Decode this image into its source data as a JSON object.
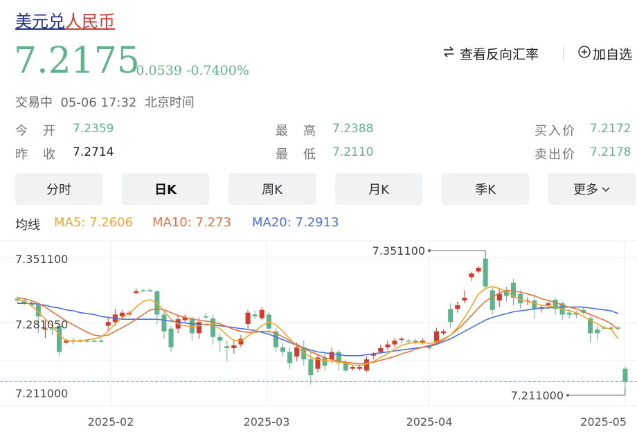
{
  "pair": {
    "base": "美元兑",
    "quote": "人民币"
  },
  "price": "7.2175",
  "change": "-0.0539",
  "change_pct": "-0.7400%",
  "actions": {
    "reverse_label": "查看反向汇率",
    "add_label": "加自选"
  },
  "status": {
    "state": "交易中",
    "time": "05-06 17:32",
    "zone": "北京时间"
  },
  "stats": {
    "open_label": "今　开",
    "open": "7.2359",
    "prev_label": "昨　收",
    "prev": "7.2714",
    "high_label": "最　高",
    "high": "7.2388",
    "low_label": "最　低",
    "low": "7.2110",
    "buy_label": "买入价",
    "buy": "7.2172",
    "sell_label": "卖出价",
    "sell": "7.2178"
  },
  "tabs": [
    "分时",
    "日K",
    "周K",
    "月K",
    "季K",
    "更多"
  ],
  "active_tab": "日K",
  "ma": {
    "label": "均线",
    "ma5": "MA5: 7.2606",
    "ma10": "MA10: 7.273",
    "ma20": "MA20: 7.2913"
  },
  "colors": {
    "up": "#d33a2c",
    "down": "#5fb38a",
    "ma5": "#f0a62a",
    "ma10": "#e0743a",
    "ma20": "#4a6fe0"
  },
  "chart_data": {
    "type": "candlestick",
    "y_ticks": [
      "7.351100",
      "7.281050",
      "7.211000"
    ],
    "x_ticks": [
      "2025-02",
      "2025-03",
      "2025-04",
      "2025-05"
    ],
    "ylim": [
      7.2,
      7.37
    ],
    "high_marker": "7.351100",
    "low_marker": "7.211000",
    "candles": [
      [
        7.307,
        7.305,
        7.309,
        7.303
      ],
      [
        7.305,
        7.302,
        7.308,
        7.3
      ],
      [
        7.302,
        7.3,
        7.304,
        7.298
      ],
      [
        7.3,
        7.288,
        7.302,
        7.27
      ],
      [
        7.274,
        7.275,
        7.285,
        7.265
      ],
      [
        7.275,
        7.274,
        7.282,
        7.268
      ],
      [
        7.278,
        7.25,
        7.28,
        7.245
      ],
      [
        7.26,
        7.262,
        7.264,
        7.258
      ],
      [
        7.262,
        7.262,
        7.265,
        7.258
      ],
      [
        7.262,
        7.262,
        7.264,
        7.26
      ],
      [
        7.262,
        7.262,
        7.264,
        7.26
      ],
      [
        7.262,
        7.262,
        7.264,
        7.26
      ],
      [
        7.262,
        7.262,
        7.264,
        7.26
      ],
      [
        7.278,
        7.282,
        7.288,
        7.272
      ],
      [
        7.282,
        7.29,
        7.296,
        7.278
      ],
      [
        7.288,
        7.292,
        7.295,
        7.285
      ],
      [
        7.29,
        7.292,
        7.294,
        7.288
      ],
      [
        7.313,
        7.315,
        7.318,
        7.312
      ],
      [
        7.316,
        7.316,
        7.318,
        7.314
      ],
      [
        7.316,
        7.316,
        7.318,
        7.314
      ],
      [
        7.315,
        7.29,
        7.316,
        7.28
      ],
      [
        7.29,
        7.272,
        7.294,
        7.264
      ],
      [
        7.275,
        7.255,
        7.278,
        7.25
      ],
      [
        7.275,
        7.285,
        7.29,
        7.27
      ],
      [
        7.284,
        7.287,
        7.29,
        7.282
      ],
      [
        7.286,
        7.27,
        7.288,
        7.262
      ],
      [
        7.27,
        7.282,
        7.287,
        7.264
      ],
      [
        7.288,
        7.287,
        7.292,
        7.285
      ],
      [
        7.286,
        7.266,
        7.29,
        7.258
      ],
      [
        7.266,
        7.262,
        7.27,
        7.25
      ],
      [
        7.256,
        7.254,
        7.262,
        7.24
      ],
      [
        7.254,
        7.257,
        7.262,
        7.248
      ],
      [
        7.258,
        7.264,
        7.268,
        7.255
      ],
      [
        7.28,
        7.292,
        7.295,
        7.275
      ],
      [
        7.29,
        7.288,
        7.294,
        7.285
      ],
      [
        7.286,
        7.295,
        7.298,
        7.284
      ],
      [
        7.29,
        7.275,
        7.293,
        7.27
      ],
      [
        7.272,
        7.255,
        7.276,
        7.25
      ],
      [
        7.255,
        7.25,
        7.26,
        7.245
      ],
      [
        7.25,
        7.238,
        7.255,
        7.232
      ],
      [
        7.245,
        7.255,
        7.26,
        7.24
      ],
      [
        7.255,
        7.242,
        7.262,
        7.235
      ],
      [
        7.242,
        7.225,
        7.25,
        7.215
      ],
      [
        7.232,
        7.244,
        7.248,
        7.228
      ],
      [
        7.244,
        7.235,
        7.248,
        7.23
      ],
      [
        7.242,
        7.25,
        7.255,
        7.238
      ],
      [
        7.25,
        7.238,
        7.252,
        7.23
      ],
      [
        7.238,
        7.23,
        7.242,
        7.228
      ],
      [
        7.232,
        7.234,
        7.236,
        7.23
      ],
      [
        7.232,
        7.234,
        7.236,
        7.23
      ],
      [
        7.23,
        7.242,
        7.245,
        7.228
      ],
      [
        7.246,
        7.248,
        7.25,
        7.242
      ],
      [
        7.25,
        7.254,
        7.258,
        7.248
      ],
      [
        7.255,
        7.258,
        7.262,
        7.252
      ],
      [
        7.258,
        7.262,
        7.265,
        7.255
      ],
      [
        7.263,
        7.264,
        7.266,
        7.26
      ],
      [
        7.262,
        7.262,
        7.264,
        7.26
      ],
      [
        7.262,
        7.26,
        7.264,
        7.258
      ],
      [
        7.26,
        7.262,
        7.265,
        7.258
      ],
      [
        7.255,
        7.255,
        7.257,
        7.252
      ],
      [
        7.26,
        7.272,
        7.276,
        7.258
      ],
      [
        7.27,
        7.272,
        7.274,
        7.268
      ],
      [
        7.296,
        7.282,
        7.302,
        7.276
      ],
      [
        7.296,
        7.3,
        7.304,
        7.292
      ],
      [
        7.305,
        7.308,
        7.316,
        7.302
      ],
      [
        7.33,
        7.334,
        7.336,
        7.326
      ],
      [
        7.336,
        7.34,
        7.342,
        7.334
      ],
      [
        7.35,
        7.32,
        7.351,
        7.318
      ],
      [
        7.316,
        7.295,
        7.32,
        7.29
      ],
      [
        7.305,
        7.312,
        7.318,
        7.298
      ],
      [
        7.316,
        7.31,
        7.32,
        7.304
      ],
      [
        7.324,
        7.308,
        7.328,
        7.3
      ],
      [
        7.312,
        7.302,
        7.316,
        7.296
      ],
      [
        7.304,
        7.305,
        7.308,
        7.3
      ],
      [
        7.305,
        7.296,
        7.312,
        7.286
      ],
      [
        7.296,
        7.298,
        7.3,
        7.292
      ],
      [
        7.3,
        7.302,
        7.304,
        7.296
      ],
      [
        7.306,
        7.296,
        7.308,
        7.29
      ],
      [
        7.302,
        7.29,
        7.304,
        7.284
      ],
      [
        7.292,
        7.29,
        7.296,
        7.286
      ],
      [
        7.292,
        7.29,
        7.294,
        7.286
      ],
      [
        7.295,
        7.292,
        7.298,
        7.29
      ],
      [
        7.286,
        7.27,
        7.288,
        7.26
      ],
      [
        7.274,
        7.27,
        7.278,
        7.262
      ],
      [
        7.276,
        7.276,
        7.278,
        7.274
      ],
      [
        7.276,
        7.276,
        7.278,
        7.274
      ],
      [
        7.276,
        7.276,
        7.278,
        7.274
      ],
      [
        7.232,
        7.218,
        7.234,
        7.211
      ]
    ],
    "ma5": [
      7.306,
      7.304,
      7.3,
      7.293,
      7.285,
      7.278,
      7.268,
      7.262,
      7.262,
      7.262,
      7.263,
      7.264,
      7.266,
      7.272,
      7.28,
      7.287,
      7.291,
      7.298,
      7.304,
      7.306,
      7.302,
      7.294,
      7.285,
      7.28,
      7.278,
      7.277,
      7.278,
      7.28,
      7.279,
      7.275,
      7.268,
      7.262,
      7.262,
      7.267,
      7.272,
      7.278,
      7.282,
      7.279,
      7.272,
      7.264,
      7.256,
      7.249,
      7.244,
      7.242,
      7.241,
      7.24,
      7.239,
      7.238,
      7.236,
      7.235,
      7.237,
      7.24,
      7.244,
      7.248,
      7.253,
      7.257,
      7.259,
      7.26,
      7.26,
      7.259,
      7.261,
      7.264,
      7.268,
      7.276,
      7.287,
      7.299,
      7.312,
      7.318,
      7.32,
      7.318,
      7.315,
      7.31,
      7.306,
      7.304,
      7.302,
      7.3,
      7.299,
      7.298,
      7.296,
      7.294,
      7.292,
      7.288,
      7.284,
      7.28,
      7.276,
      7.274,
      7.264
    ],
    "ma10": [
      7.308,
      7.307,
      7.305,
      7.302,
      7.298,
      7.293,
      7.288,
      7.283,
      7.279,
      7.275,
      7.271,
      7.268,
      7.267,
      7.268,
      7.272,
      7.276,
      7.28,
      7.285,
      7.29,
      7.295,
      7.296,
      7.295,
      7.292,
      7.289,
      7.287,
      7.285,
      7.284,
      7.283,
      7.282,
      7.28,
      7.277,
      7.274,
      7.272,
      7.271,
      7.271,
      7.272,
      7.272,
      7.27,
      7.266,
      7.262,
      7.258,
      7.254,
      7.25,
      7.247,
      7.244,
      7.242,
      7.24,
      7.239,
      7.238,
      7.237,
      7.238,
      7.239,
      7.241,
      7.243,
      7.245,
      7.248,
      7.25,
      7.253,
      7.255,
      7.257,
      7.259,
      7.263,
      7.268,
      7.274,
      7.281,
      7.289,
      7.297,
      7.304,
      7.309,
      7.313,
      7.316,
      7.315,
      7.314,
      7.312,
      7.31,
      7.307,
      7.305,
      7.303,
      7.3,
      7.298,
      7.296,
      7.293,
      7.29,
      7.287,
      7.284,
      7.28,
      7.274
    ],
    "ma20": [
      7.302,
      7.302,
      7.302,
      7.301,
      7.3,
      7.298,
      7.297,
      7.295,
      7.294,
      7.292,
      7.291,
      7.29,
      7.288,
      7.287,
      7.286,
      7.285,
      7.285,
      7.285,
      7.285,
      7.285,
      7.285,
      7.284,
      7.283,
      7.282,
      7.281,
      7.28,
      7.28,
      7.279,
      7.279,
      7.278,
      7.277,
      7.276,
      7.275,
      7.274,
      7.273,
      7.271,
      7.269,
      7.266,
      7.263,
      7.26,
      7.257,
      7.254,
      7.252,
      7.25,
      7.249,
      7.248,
      7.247,
      7.246,
      7.246,
      7.246,
      7.247,
      7.248,
      7.249,
      7.25,
      7.251,
      7.252,
      7.253,
      7.254,
      7.255,
      7.256,
      7.258,
      7.261,
      7.264,
      7.268,
      7.272,
      7.276,
      7.28,
      7.284,
      7.287,
      7.289,
      7.291,
      7.293,
      7.294,
      7.295,
      7.296,
      7.297,
      7.297,
      7.298,
      7.298,
      7.298,
      7.298,
      7.298,
      7.297,
      7.296,
      7.295,
      7.294,
      7.291
    ]
  }
}
